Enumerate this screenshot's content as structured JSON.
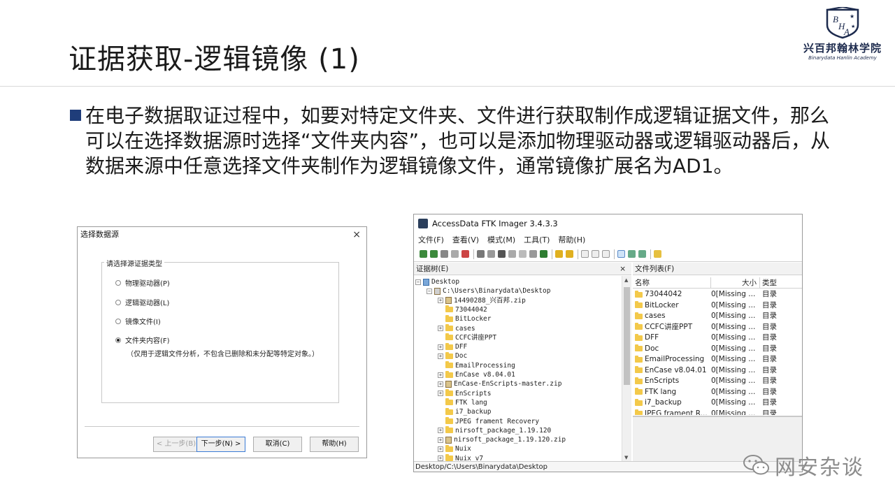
{
  "slide": {
    "title": "证据获取-逻辑镜像 (1)",
    "bullet": "在电子数据取证过程中，如要对特定文件夹、文件进行获取制作成逻辑证据文件，那么可以在选择数据源时选择“文件夹内容”，也可以是添加物理驱动器或逻辑驱动器后，从数据来源中任意选择文件夹制作为逻辑镜像文件，通常镜像扩展名为AD1。"
  },
  "logo": {
    "name_cn": "兴百邦翰林学院",
    "name_en": "Binarydata Hanlin Academy",
    "emblem_letters": "BHA"
  },
  "dialog": {
    "title": "选择数据源",
    "close": "×",
    "group_label": "请选择源证据类型",
    "options": [
      {
        "label": "物理驱动器(P)",
        "selected": false
      },
      {
        "label": "逻辑驱动器(L)",
        "selected": false
      },
      {
        "label": "镜像文件(I)",
        "selected": false
      },
      {
        "label": "文件夹内容(F)",
        "selected": true
      }
    ],
    "note": "（仅用于逻辑文件分析，不包含已删除和未分配等特定对象。）",
    "buttons": {
      "back": "< 上一步(B)",
      "next": "下一步(N) >",
      "cancel": "取消(C)",
      "help": "帮助(H)"
    }
  },
  "ftk": {
    "title": "AccessData FTK Imager 3.4.3.3",
    "menu": [
      "文件(F)",
      "查看(V)",
      "模式(M)",
      "工具(T)",
      "帮助(H)"
    ],
    "tree_pane_title": "证据树(E)",
    "tree_pane_close": "×",
    "file_pane_title": "文件列表(F)",
    "tree_items": [
      {
        "label": "Desktop",
        "kind": "root"
      },
      {
        "label": "C:\\Users\\Binarydata\\Desktop",
        "kind": "path"
      },
      {
        "label": "14490288_兴百邦.zip",
        "kind": "zip",
        "expand": true
      },
      {
        "label": "73044042",
        "kind": "folder",
        "expand": false
      },
      {
        "label": "BitLocker",
        "kind": "folder",
        "expand": false
      },
      {
        "label": "cases",
        "kind": "folder",
        "expand": true
      },
      {
        "label": "CCFC讲座PPT",
        "kind": "folder",
        "expand": false
      },
      {
        "label": "DFF",
        "kind": "folder",
        "expand": true
      },
      {
        "label": "Doc",
        "kind": "folder",
        "expand": true
      },
      {
        "label": "EmailProcessing",
        "kind": "folder",
        "expand": false
      },
      {
        "label": "EnCase v8.04.01",
        "kind": "folder",
        "expand": true
      },
      {
        "label": "EnCase-EnScripts-master.zip",
        "kind": "zip",
        "expand": true
      },
      {
        "label": "EnScripts",
        "kind": "folder",
        "expand": true
      },
      {
        "label": "FTK lang",
        "kind": "folder",
        "expand": false
      },
      {
        "label": "i7_backup",
        "kind": "folder",
        "expand": false
      },
      {
        "label": "JPEG frament Recovery",
        "kind": "folder",
        "expand": false
      },
      {
        "label": "nirsoft_package_1.19.120",
        "kind": "folder",
        "expand": true
      },
      {
        "label": "nirsoft_package_1.19.120.zip",
        "kind": "zip",
        "expand": true
      },
      {
        "label": "Nuix",
        "kind": "folder",
        "expand": true
      },
      {
        "label": "Nuix v7",
        "kind": "folder",
        "expand": true
      }
    ],
    "file_columns": {
      "name": "名称",
      "size": "大小",
      "type": "类型"
    },
    "files": [
      {
        "name": "73044042",
        "size": "0[Missing ...",
        "type": "目录"
      },
      {
        "name": "BitLocker",
        "size": "0[Missing ...",
        "type": "目录"
      },
      {
        "name": "cases",
        "size": "0[Missing ...",
        "type": "目录"
      },
      {
        "name": "CCFC讲座PPT",
        "size": "0[Missing ...",
        "type": "目录"
      },
      {
        "name": "DFF",
        "size": "0[Missing ...",
        "type": "目录"
      },
      {
        "name": "Doc",
        "size": "0[Missing ...",
        "type": "目录"
      },
      {
        "name": "EmailProcessing",
        "size": "0[Missing ...",
        "type": "目录"
      },
      {
        "name": "EnCase v8.04.01",
        "size": "0[Missing ...",
        "type": "目录"
      },
      {
        "name": "EnScripts",
        "size": "0[Missing ...",
        "type": "目录"
      },
      {
        "name": "FTK lang",
        "size": "0[Missing ...",
        "type": "目录"
      },
      {
        "name": "i7_backup",
        "size": "0[Missing ...",
        "type": "目录"
      },
      {
        "name": "JPEG frament R...",
        "size": "0[Missing ...",
        "type": "目录"
      }
    ],
    "status": "Desktop/C:\\Users\\Binarydata\\Desktop"
  },
  "watermark": {
    "text": "网安杂谈"
  },
  "colors": {
    "bullet": "#1f3d7a",
    "logo": "#1c2a4d",
    "folder": "#f3c94a"
  }
}
